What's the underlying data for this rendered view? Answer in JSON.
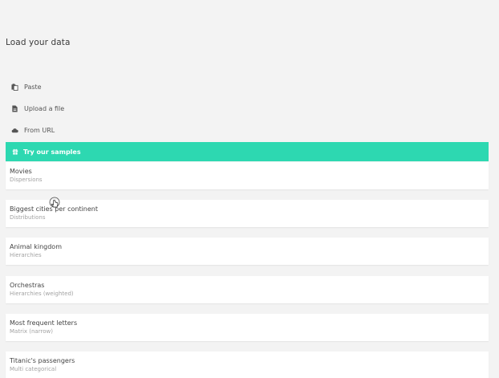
{
  "page_title": "Load your data",
  "menu": [
    {
      "label": "Paste",
      "icon": "paste-icon"
    },
    {
      "label": "Upload a file",
      "icon": "file-icon"
    },
    {
      "label": "From URL",
      "icon": "cloud-icon"
    }
  ],
  "samples_header": {
    "label": "Try our samples",
    "icon": "gift-icon",
    "color": "#2dd8b1"
  },
  "samples": [
    {
      "name": "Movies",
      "kind": "Dispersions"
    },
    {
      "name": "Biggest cities per continent",
      "kind": "Distributions"
    },
    {
      "name": "Animal kingdom",
      "kind": "Hierarchies"
    },
    {
      "name": "Orchestras",
      "kind": "Hierarchies (weighted)"
    },
    {
      "name": "Most frequent letters",
      "kind": "Matrix (narrow)"
    },
    {
      "name": "Titanic's passengers",
      "kind": "Multi categorical"
    }
  ]
}
